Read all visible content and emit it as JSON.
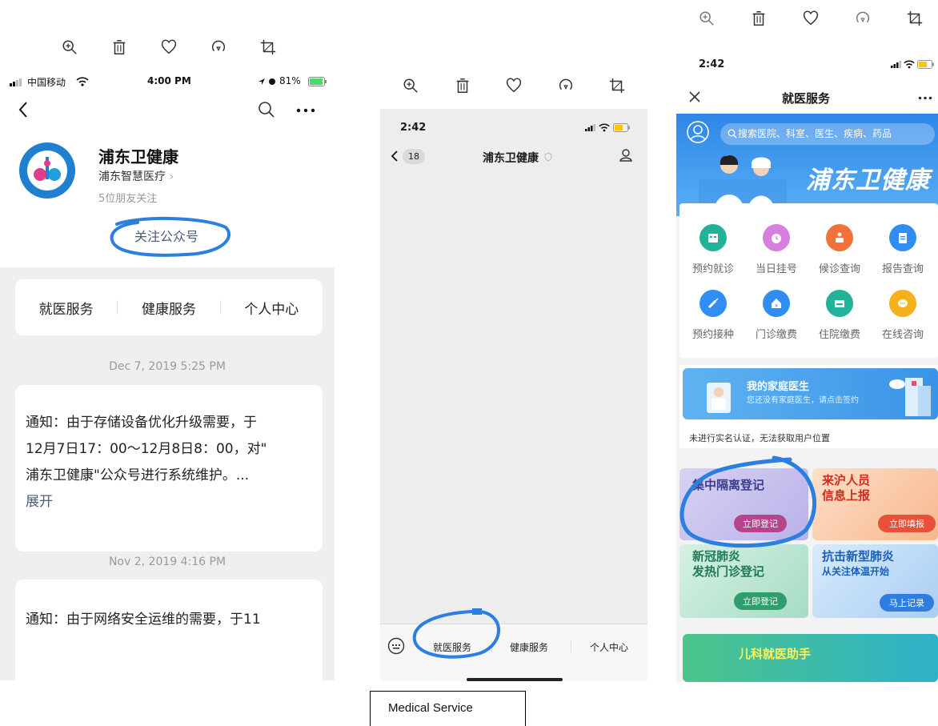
{
  "screen1": {
    "status": {
      "carrier": "中国移动",
      "time": "4:00 PM",
      "battery": "81%"
    },
    "account_name": "浦东卫健康",
    "account_sub": "浦东智慧医疗",
    "friends_following": "5位朋友关注",
    "follow_button": "关注公众号",
    "menu": [
      "就医服务",
      "健康服务",
      "个人中心"
    ],
    "messages": [
      {
        "date": "Dec 7, 2019 5:25 PM",
        "lines": [
          "通知：由于存储设备优化升级需要，于",
          "12月7日17：00～12月8日8：00，对\"",
          "浦东卫健康\"公众号进行系统维护。..."
        ],
        "expand": "展开"
      },
      {
        "date": "Nov 2, 2019 4:16 PM",
        "lines": [
          "通知：由于网络安全运维的需要，于11"
        ]
      }
    ]
  },
  "screen2": {
    "status": {
      "time": "2:42"
    },
    "back_count": "18",
    "title": "浦东卫健康",
    "menu": [
      "就医服务",
      "健康服务",
      "个人中心"
    ]
  },
  "screen3": {
    "status": {
      "time": "2:42"
    },
    "title": "就医服务",
    "search_placeholder": "搜索医院、科室、医生、疾病、药品",
    "brand": "浦东卫健康",
    "grid": [
      "预约就诊",
      "当日挂号",
      "候诊查询",
      "报告查询",
      "预约接种",
      "门诊缴费",
      "住院缴费",
      "在线咨询"
    ],
    "family_doctor": {
      "title": "我的家庭医生",
      "subtitle": "您还没有家庭医生，请点击签约"
    },
    "location_notice": "未进行实名认证，无法获取用户位置",
    "banners": [
      {
        "title": "集中隔离登记",
        "button": "立即登记"
      },
      {
        "title_l1": "来沪人员",
        "title_l2": "信息上报",
        "button": "立即填报"
      },
      {
        "title_l1": "新冠肺炎",
        "title_l2": "发热门诊登记",
        "button": "立即登记"
      },
      {
        "title_l1": "抗击新型肺炎",
        "title_l2": "从关注体温开始",
        "button": "马上记录"
      }
    ],
    "bottom_banner": "儿科就医助手"
  },
  "caption": "Medical Service",
  "colors": {
    "accent_blue": "#2f8ef0",
    "annotation_blue": "#2a7fe0",
    "link_blue": "#4b5d7e",
    "magenta": "#b4458a"
  }
}
